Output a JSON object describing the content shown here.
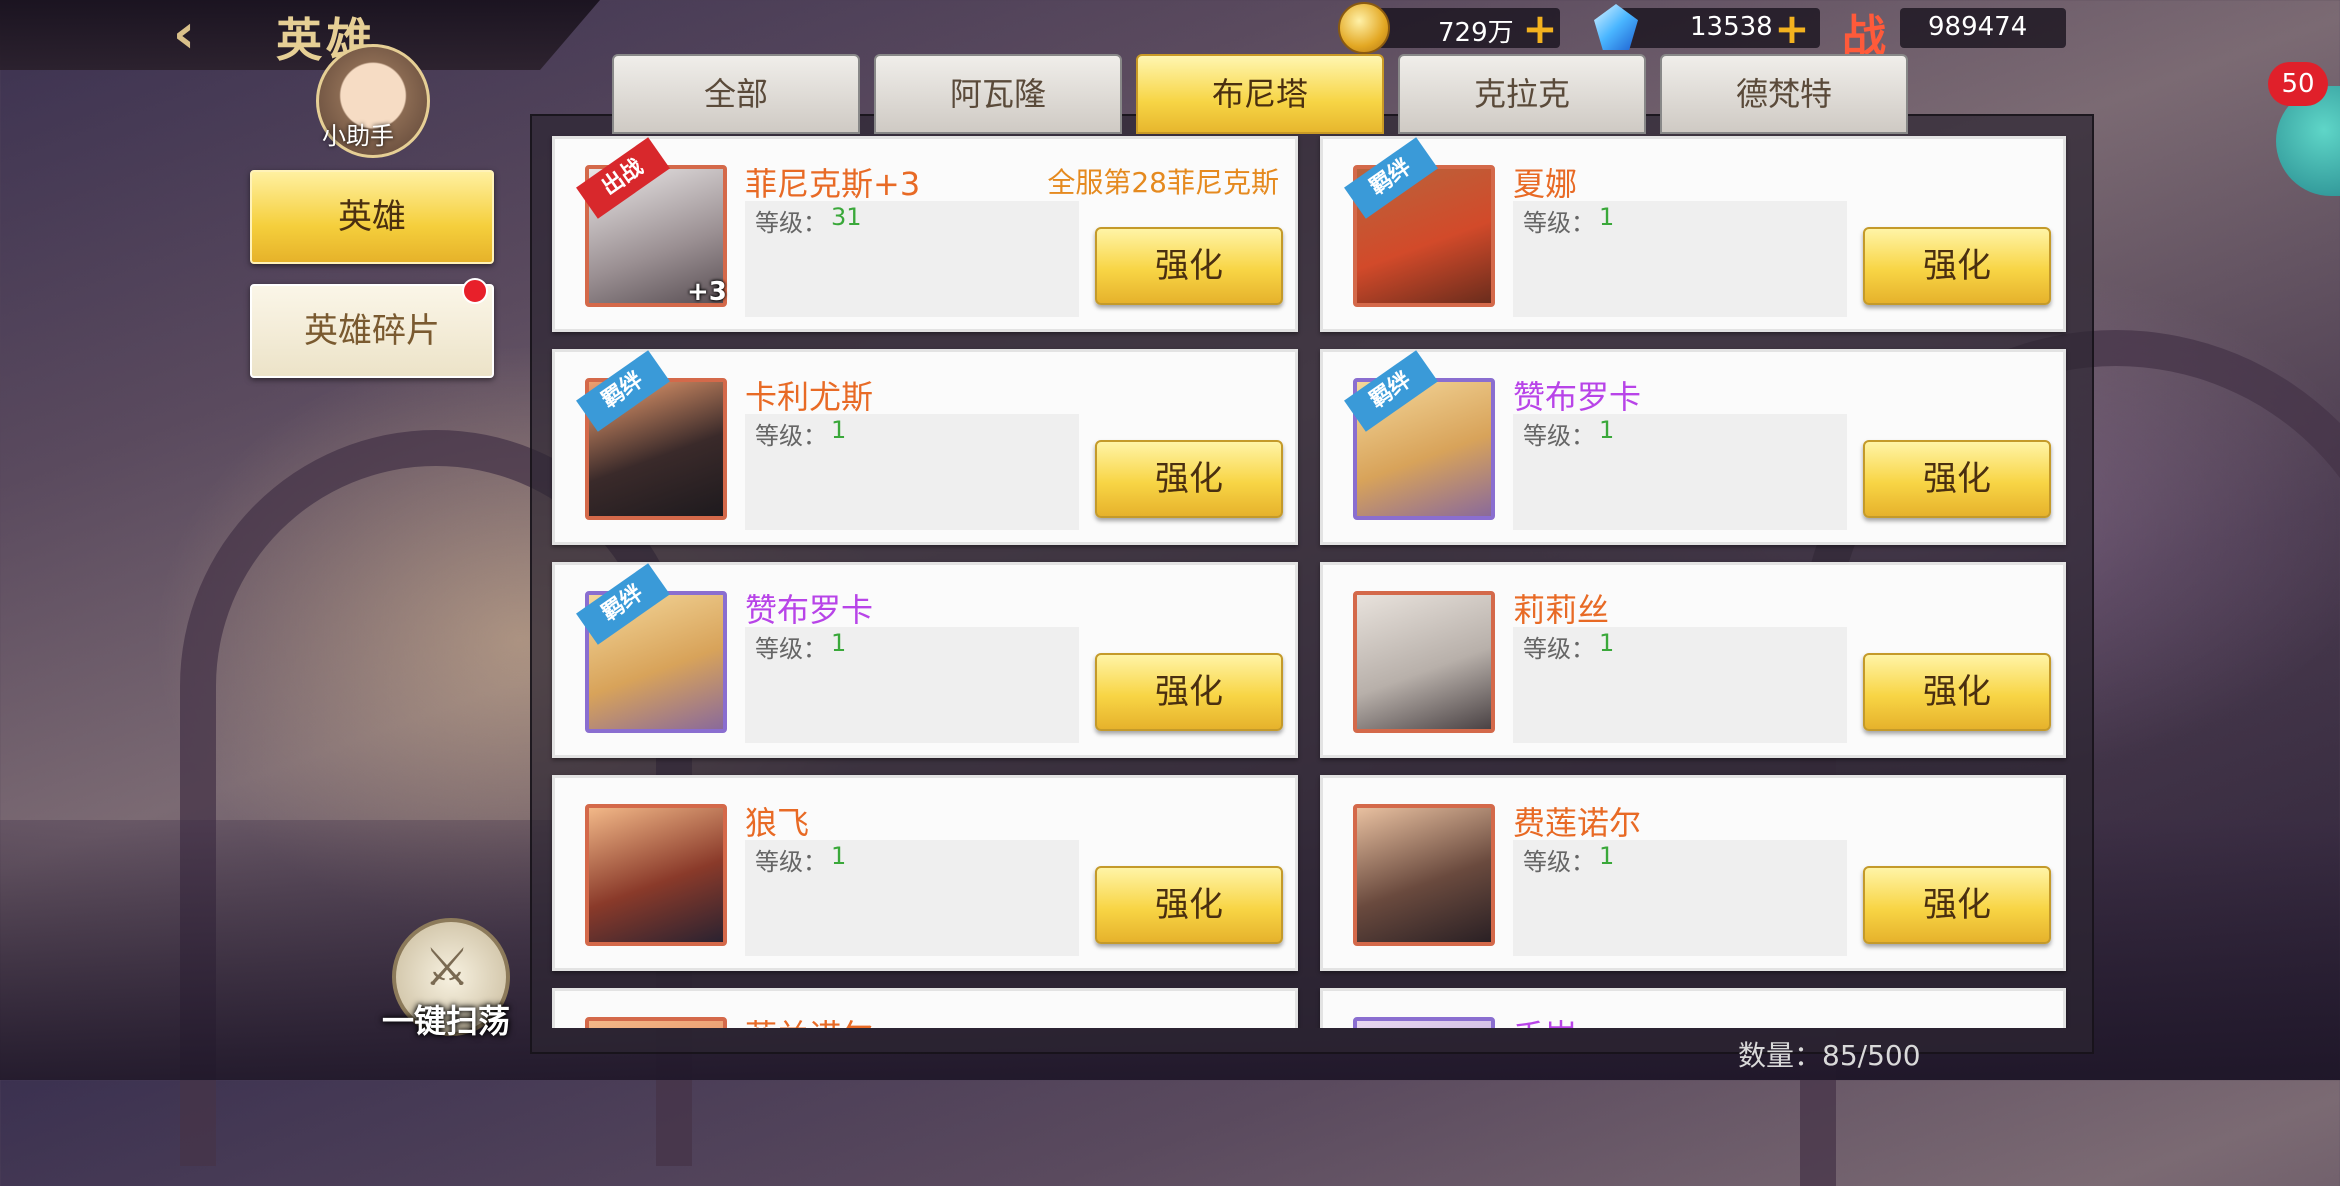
{
  "header": {
    "title": "英雄",
    "back": "‹"
  },
  "resources": {
    "gold": "729万",
    "gems": "13538",
    "power_label": "战",
    "power": "989474"
  },
  "notification_count": "50",
  "assistant": {
    "label": "小助手"
  },
  "nav": {
    "heroes": "英雄",
    "fragments": "英雄碎片"
  },
  "tabs": [
    "全部",
    "阿瓦隆",
    "布尼塔",
    "克拉克",
    "德梵特"
  ],
  "active_tab": "布尼塔",
  "level_label": "等级：",
  "enhance_label": "强化",
  "cards": [
    {
      "name": "菲尼克斯+3",
      "level": "31",
      "tag": "出战",
      "plus": "+3",
      "rank": "全服第28菲尼克斯",
      "name_color": "orange"
    },
    {
      "name": "夏娜",
      "level": "1",
      "tag": "羁绊",
      "name_color": "orange"
    },
    {
      "name": "卡利尤斯",
      "level": "1",
      "tag": "羁绊",
      "name_color": "orange"
    },
    {
      "name": "赞布罗卡",
      "level": "1",
      "tag": "羁绊",
      "name_color": "purple"
    },
    {
      "name": "赞布罗卡",
      "level": "1",
      "tag": "羁绊",
      "name_color": "purple"
    },
    {
      "name": "莉莉丝",
      "level": "1",
      "name_color": "orange"
    },
    {
      "name": "狼飞",
      "level": "1",
      "name_color": "orange"
    },
    {
      "name": "费莲诺尔",
      "level": "1",
      "name_color": "orange"
    },
    {
      "name": "菲兰诺尔",
      "name_color": "orange"
    },
    {
      "name": "千岩",
      "name_color": "purple"
    }
  ],
  "sweep": {
    "label": "一键扫荡"
  },
  "count": "数量：85/500",
  "colors": {
    "accent_gold": "#f5cf3c",
    "name_orange": "#e86a25",
    "name_purple": "#b844e8",
    "level_green": "#3aa83a"
  }
}
